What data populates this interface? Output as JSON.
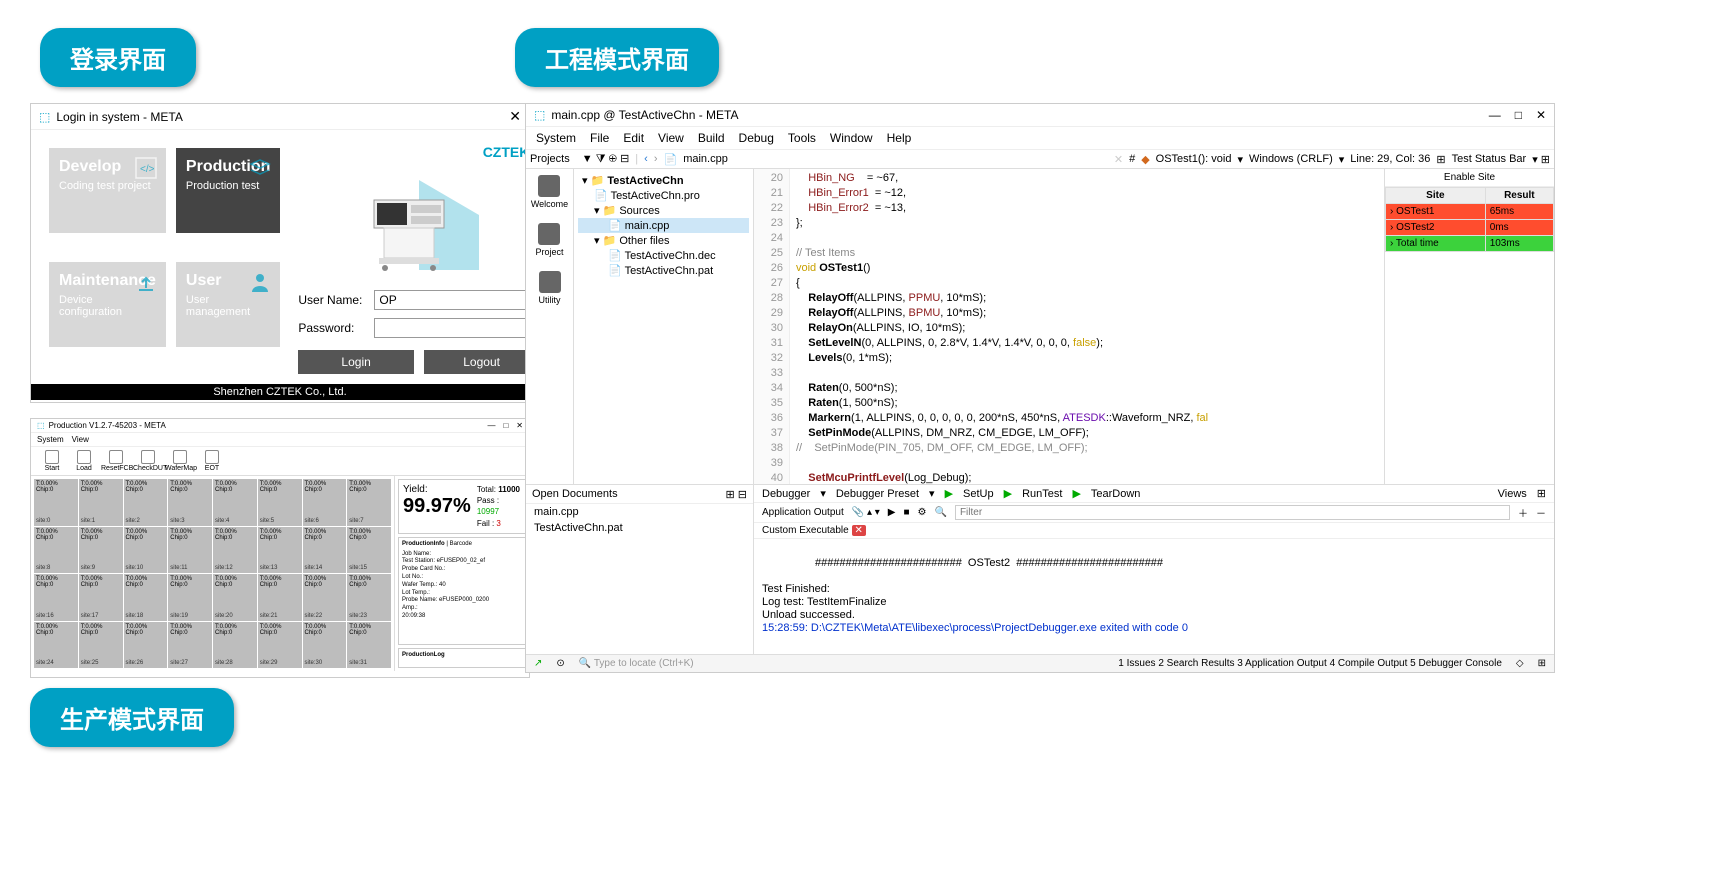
{
  "badges": {
    "login": "登录界面",
    "eng": "工程模式界面",
    "prod": "生产模式界面"
  },
  "login": {
    "title": "Login in system - META",
    "tiles": {
      "develop": {
        "title": "Develop",
        "sub": "Coding test project"
      },
      "production": {
        "title": "Production",
        "sub": "Production test"
      },
      "maintenance": {
        "title": "Maintenance",
        "sub": "Device configuration"
      },
      "user": {
        "title": "User",
        "sub": "User management"
      }
    },
    "brand": "CZTEK",
    "username_label": "User Name:",
    "username_value": "OP",
    "password_label": "Password:",
    "password_value": "",
    "login_btn": "Login",
    "logout_btn": "Logout",
    "footer": "Shenzhen CZTEK Co., Ltd."
  },
  "prod": {
    "title": "Production V1.2.7-45203 - META",
    "menu": [
      "System",
      "View"
    ],
    "toolbar": [
      "Start",
      "Load",
      "ResetFCB",
      "CheckDUT",
      "WaferMap",
      "EOT"
    ],
    "yield_label": "Yield:",
    "yield_value": "99.97%",
    "total_label": "Total:",
    "total_value": "11000",
    "pass_label": "Pass :",
    "pass_value": "10997",
    "fail_label": "Fail :",
    "fail_value": "3",
    "cells": [
      "site:0",
      "site:1",
      "site:2",
      "site:3",
      "site:4",
      "site:5",
      "site:6",
      "site:7",
      "site:8",
      "site:9",
      "site:10",
      "site:11",
      "site:12",
      "site:13",
      "site:14",
      "site:15",
      "site:16",
      "site:17",
      "site:18",
      "site:19",
      "site:20",
      "site:21",
      "site:22",
      "site:23",
      "site:24",
      "site:25",
      "site:26",
      "site:27",
      "site:28",
      "site:29",
      "site:30",
      "site:31"
    ],
    "cell_top": "T:0.00%",
    "cell_chip": "Chip:0",
    "production_info_hdr": "ProductionInfo",
    "production_info": "Job Name:\nTest Station:  eFUSEP00_02_ef\nProbe Card No.:\nLot No.:\nWafer Temp.: 40\nLot Temp.:\nProbe Name: eFUSEP000_0200\nAmp.:\n20:09:38",
    "barcode_hdr": "Barcode",
    "prodlog_hdr": "ProductionLog"
  },
  "ide": {
    "title": "main.cpp @ TestActiveChn - META",
    "menu": [
      "System",
      "File",
      "Edit",
      "View",
      "Build",
      "Debug",
      "Tools",
      "Window",
      "Help"
    ],
    "projects_hdr": "Projects",
    "sidebar": [
      "Welcome",
      "Project",
      "Utility"
    ],
    "tree": {
      "root": "TestActiveChn",
      "pro": "TestActiveChn.pro",
      "sources": "Sources",
      "main": "main.cpp",
      "other": "Other files",
      "dec": "TestActiveChn.dec",
      "pat": "TestActiveChn.pat"
    },
    "tab_file": "main.cpp",
    "breadcrumb_fn": "OSTest1(): void",
    "encoding": "Windows (CRLF)",
    "cursor": "Line: 29, Col: 36",
    "right_hdr1": "Test Status Bar",
    "right_hdr2": "Enable Site",
    "right_cols": [
      "Site",
      "Result"
    ],
    "right_rows": [
      {
        "site": "OSTest1",
        "result": "65ms",
        "cls": "red"
      },
      {
        "site": "OSTest2",
        "result": "0ms",
        "cls": "red"
      },
      {
        "site": "Total time",
        "result": "103ms",
        "cls": "green"
      }
    ],
    "code_lines": [
      {
        "n": 20,
        "html": "    <span class='c-var'>HBin_NG</span>    = ~67,"
      },
      {
        "n": 21,
        "html": "    <span class='c-var'>HBin_Error1</span>  = ~12,"
      },
      {
        "n": 22,
        "html": "    <span class='c-var'>HBin_Error2</span>  = ~13,"
      },
      {
        "n": 23,
        "html": "};"
      },
      {
        "n": 24,
        "html": ""
      },
      {
        "n": 25,
        "html": "<span class='c-cm'>// Test Items</span>"
      },
      {
        "n": 26,
        "html": "<span class='c-kw'>void</span> <span class='c-fn'>OSTest1</span>()"
      },
      {
        "n": 27,
        "html": "{"
      },
      {
        "n": 28,
        "html": "    <span class='c-fn'>RelayOff</span>(ALLPINS, <span class='c-var'>PPMU</span>, 10*mS);"
      },
      {
        "n": 29,
        "html": "    <span class='c-fn'>RelayOff</span>(ALLPINS, <span class='c-var'>BPMU</span>, 10*mS);"
      },
      {
        "n": 30,
        "html": "    <span class='c-fn'>RelayOn</span>(ALLPINS, IO, 10*mS);"
      },
      {
        "n": 31,
        "html": "    <span class='c-fn'>SetLevelN</span>(0, ALLPINS, 0, 2.8*V, 1.4*V, 1.4*V, 0, 0, 0, <span class='c-kw'>false</span>);"
      },
      {
        "n": 32,
        "html": "    <span class='c-fn'>Levels</span>(0, 1*mS);"
      },
      {
        "n": 33,
        "html": ""
      },
      {
        "n": 34,
        "html": "    <span class='c-fn'>Raten</span>(0, 500*nS);"
      },
      {
        "n": 35,
        "html": "    <span class='c-fn'>Raten</span>(1, 500*nS);"
      },
      {
        "n": 36,
        "html": "    <span class='c-fn'>Markern</span>(1, ALLPINS, 0, 0, 0, 0, 0, 200*nS, 450*nS, <span class='c-type'>ATESDK</span>::Waveform_NRZ, <span class='c-kw'>fal</span>"
      },
      {
        "n": 37,
        "html": "    <span class='c-fn'>SetPinMode</span>(ALLPINS, DM_NRZ, CM_EDGE, LM_OFF);"
      },
      {
        "n": 38,
        "html": "<span class='c-cm'>//    SetPinMode(PIN_705, DM_OFF, CM_EDGE, LM_OFF);</span>"
      },
      {
        "n": 39,
        "html": ""
      },
      {
        "n": 40,
        "html": "    <span class='c-fn' style='color:#8b1a1a'>SetMcuPrintfLevel</span>(Log_Debug);"
      }
    ],
    "open_docs_hdr": "Open Documents",
    "open_docs": [
      "main.cpp",
      "TestActiveChn.pat"
    ],
    "debugger_label": "Debugger",
    "debugger_preset": "Debugger Preset",
    "setup": "SetUp",
    "runtest": "RunTest",
    "teardown": "TearDown",
    "views": "Views",
    "app_output": "Application Output",
    "filter_ph": "Filter",
    "custom_exe": "Custom Executable",
    "console_text": "########################  OSTest2  ########################\n\nTest Finished:\nLog test: TestItemFinalize\nUnload successed.",
    "console_exit": "15:28:59: D:\\CZTEK\\Meta\\ATE\\libexec\\process\\ProjectDebugger.exe exited with code 0",
    "status_locate": "Type to locate (Ctrl+K)",
    "status_tabs": [
      "1 Issues",
      "2 Search Results",
      "3 Application Output",
      "4 Compile Output",
      "5 Debugger Console"
    ]
  }
}
